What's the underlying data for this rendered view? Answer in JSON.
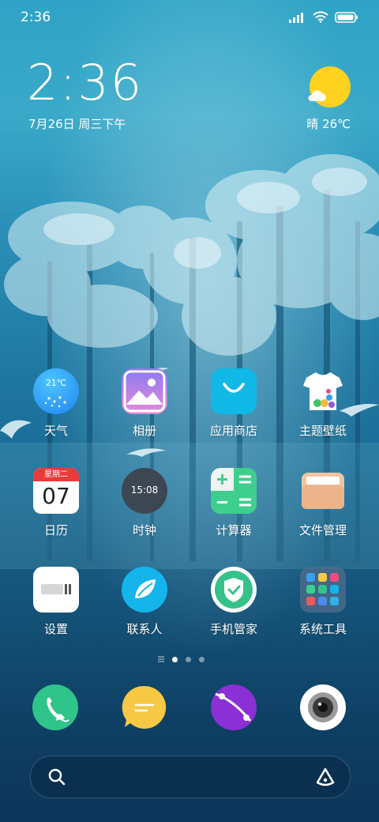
{
  "status_bar": {
    "time": "2:36"
  },
  "clock_widget": {
    "time": "2:36",
    "date": "7月26日 周三下午"
  },
  "weather_widget": {
    "text": "晴 26℃"
  },
  "apps": [
    {
      "label": "天气",
      "icon_text": "21℃",
      "icon": "weather-icon"
    },
    {
      "label": "相册",
      "icon": "gallery-icon"
    },
    {
      "label": "应用商店",
      "icon": "app-store-icon"
    },
    {
      "label": "主题壁纸",
      "icon": "themes-icon"
    },
    {
      "label": "日历",
      "icon_top": "星期二",
      "icon_day": "07",
      "icon": "calendar-icon"
    },
    {
      "label": "时钟",
      "icon_text": "15:08",
      "icon": "clock-icon"
    },
    {
      "label": "计算器",
      "icon": "calculator-icon"
    },
    {
      "label": "文件管理",
      "icon": "file-manager-icon"
    },
    {
      "label": "设置",
      "icon": "settings-icon"
    },
    {
      "label": "联系人",
      "icon": "contacts-icon"
    },
    {
      "label": "手机管家",
      "icon": "security-icon"
    },
    {
      "label": "系统工具",
      "icon": "system-tools-folder-icon"
    }
  ],
  "page_indicator": {
    "pages": 3,
    "current": 1
  },
  "dock": [
    {
      "icon": "phone-icon"
    },
    {
      "icon": "messages-icon"
    },
    {
      "icon": "browser-icon"
    },
    {
      "icon": "camera-icon"
    }
  ],
  "search_bar": {
    "left_icon": "search-icon",
    "right_icon": "assistant-icon"
  },
  "colors": {
    "sun": "#ffd21f",
    "app_store": "#10b9e6",
    "calculator": "#3ecf8e",
    "security": "#35c28a",
    "browser": "#8b2fd6",
    "phone": "#2ec48a",
    "messages": "#f6c844"
  }
}
